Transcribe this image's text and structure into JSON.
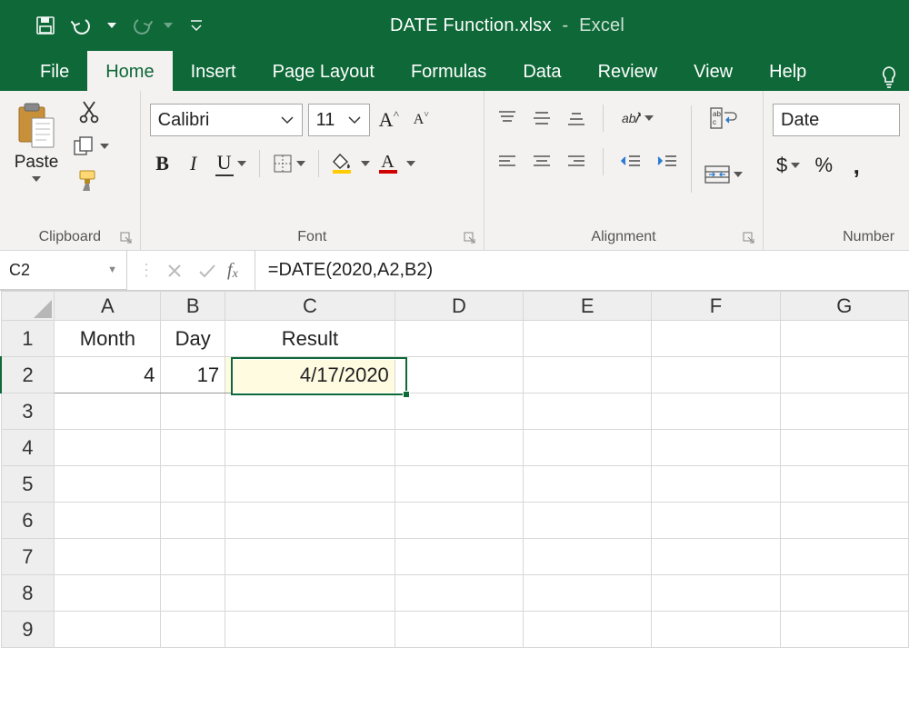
{
  "title": {
    "filename": "DATE Function.xlsx",
    "separator": "-",
    "app": "Excel"
  },
  "ribbon_tabs": [
    "File",
    "Home",
    "Insert",
    "Page Layout",
    "Formulas",
    "Data",
    "Review",
    "View",
    "Help"
  ],
  "active_tab": "Home",
  "clipboard": {
    "paste_label": "Paste",
    "group_label": "Clipboard"
  },
  "font": {
    "group_label": "Font",
    "family": "Calibri",
    "size": "11",
    "bold": "B",
    "italic": "I",
    "underline": "U"
  },
  "alignment": {
    "group_label": "Alignment"
  },
  "number": {
    "group_label": "Number",
    "format_selected": "Date",
    "currency": "$",
    "percent": "%",
    "comma": ","
  },
  "namebox": {
    "value": "C2"
  },
  "formula": {
    "value": "=DATE(2020,A2,B2)"
  },
  "columns": [
    "A",
    "B",
    "C",
    "D",
    "E",
    "F",
    "G"
  ],
  "rows": [
    "1",
    "2",
    "3",
    "4",
    "5",
    "6",
    "7",
    "8",
    "9"
  ],
  "cells": {
    "A1": "Month",
    "B1": "Day",
    "C1": "Result",
    "A2": "4",
    "B2": "17",
    "C2": "4/17/2020"
  },
  "active_cell": "C2"
}
